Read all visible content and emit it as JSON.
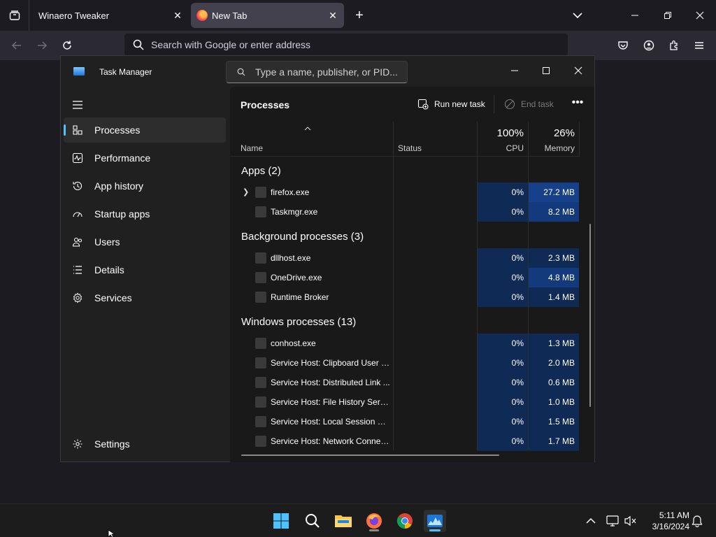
{
  "browser": {
    "tabs": [
      {
        "label": "Winaero Tweaker",
        "active": false
      },
      {
        "label": "New Tab",
        "active": true
      }
    ],
    "address_placeholder": "Search with Google or enter address"
  },
  "taskmanager": {
    "title": "Task Manager",
    "search_placeholder": "Type a name, publisher, or PID...",
    "sidebar": [
      {
        "label": "Processes",
        "icon": "processes-icon",
        "active": true
      },
      {
        "label": "Performance",
        "icon": "performance-icon"
      },
      {
        "label": "App history",
        "icon": "app-history-icon"
      },
      {
        "label": "Startup apps",
        "icon": "startup-icon"
      },
      {
        "label": "Users",
        "icon": "users-icon"
      },
      {
        "label": "Details",
        "icon": "details-icon"
      },
      {
        "label": "Services",
        "icon": "services-icon"
      }
    ],
    "settings_label": "Settings",
    "page_title": "Processes",
    "run_new_task": "Run new task",
    "end_task": "End task",
    "columns": {
      "name": "Name",
      "status": "Status",
      "cpu_total": "100%",
      "cpu": "CPU",
      "memory_total": "26%",
      "memory": "Memory"
    },
    "groups": [
      {
        "label": "Apps (2)",
        "rows": [
          {
            "name": "firefox.exe",
            "cpu": "0%",
            "mem": "27.2 MB",
            "expandable": true
          },
          {
            "name": "Taskmgr.exe",
            "cpu": "0%",
            "mem": "8.2 MB"
          }
        ]
      },
      {
        "label": "Background processes (3)",
        "rows": [
          {
            "name": "dllhost.exe",
            "cpu": "0%",
            "mem": "2.3 MB"
          },
          {
            "name": "OneDrive.exe",
            "cpu": "0%",
            "mem": "4.8 MB"
          },
          {
            "name": "Runtime Broker",
            "cpu": "0%",
            "mem": "1.4 MB"
          }
        ]
      },
      {
        "label": "Windows processes (13)",
        "rows": [
          {
            "name": "conhost.exe",
            "cpu": "0%",
            "mem": "1.3 MB"
          },
          {
            "name": "Service Host: Clipboard User S...",
            "cpu": "0%",
            "mem": "2.0 MB"
          },
          {
            "name": "Service Host: Distributed Link ...",
            "cpu": "0%",
            "mem": "0.6 MB"
          },
          {
            "name": "Service Host: File History Servi...",
            "cpu": "0%",
            "mem": "1.0 MB"
          },
          {
            "name": "Service Host: Local Session M...",
            "cpu": "0%",
            "mem": "1.5 MB"
          },
          {
            "name": "Service Host: Network Connec...",
            "cpu": "0%",
            "mem": "1.7 MB"
          }
        ]
      }
    ]
  },
  "taskbar": {
    "apps": [
      "start-icon",
      "search-icon",
      "file-explorer-icon",
      "firefox-icon",
      "chrome-icon",
      "task-manager-icon"
    ],
    "time": "5:11 AM",
    "date": "3/16/2024"
  },
  "colors": {
    "accent": "#4cc2ff",
    "heat_low": "#0f2a55",
    "heat_high": "#16418a"
  }
}
